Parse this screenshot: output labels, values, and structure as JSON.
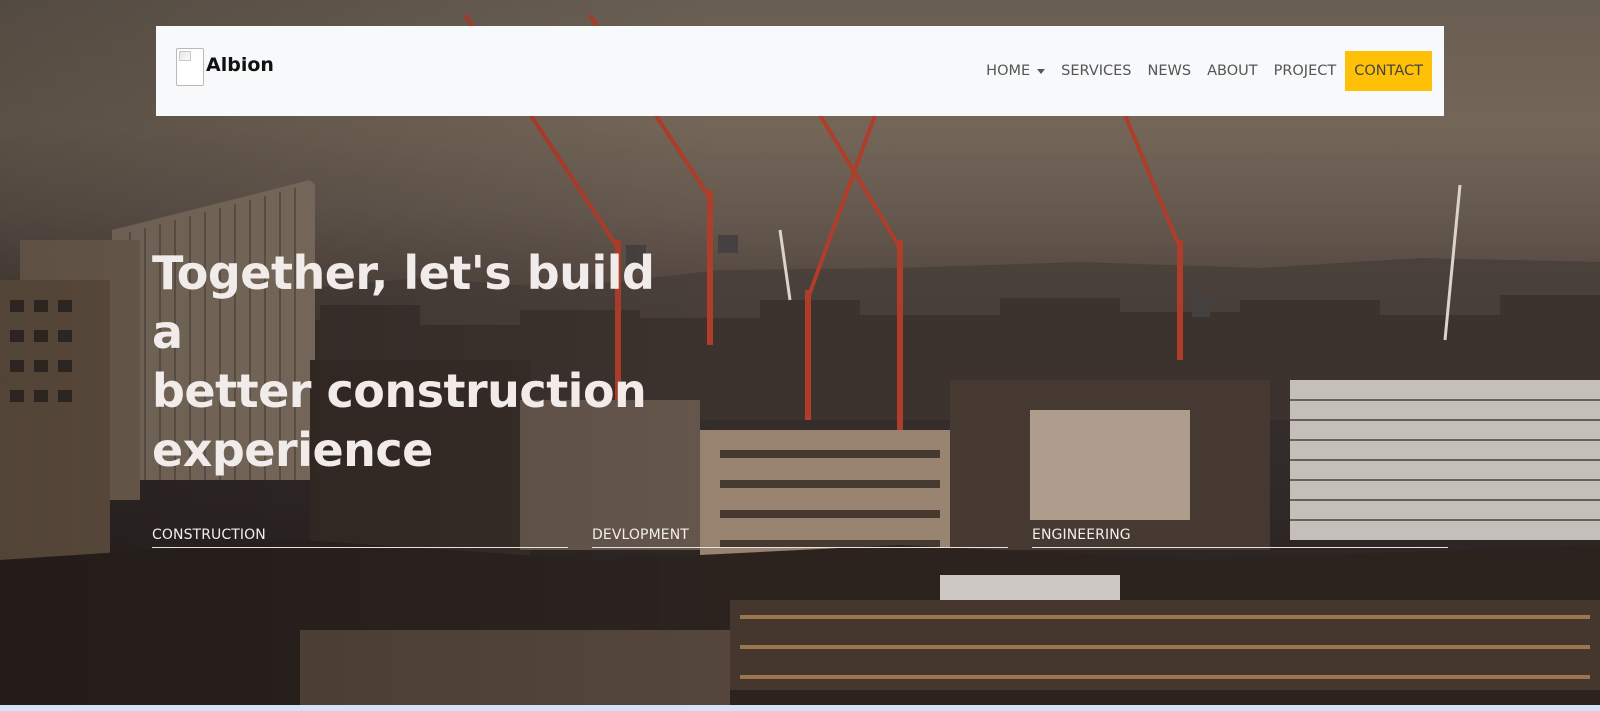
{
  "brand": {
    "name": "Albion",
    "logo_icon": "broken-image-icon"
  },
  "nav": {
    "home": "HOME",
    "services": "SERVICES",
    "news": "NEWS",
    "about": "ABOUT",
    "project": "PROJECT",
    "contact": "CONTACT"
  },
  "hero": {
    "title_line1": "Together, let's build a",
    "title_line2": "better construction",
    "title_line3": "experience"
  },
  "services": [
    {
      "label": "CONSTRUCTION"
    },
    {
      "label": "DEVLOPMENT"
    },
    {
      "label": "ENGINEERING"
    }
  ],
  "colors": {
    "navbar_bg": "#f8f9fa",
    "contact_accent": "#ffc107",
    "crane_red": "#c0392b",
    "hero_text": "#f1ecea"
  }
}
